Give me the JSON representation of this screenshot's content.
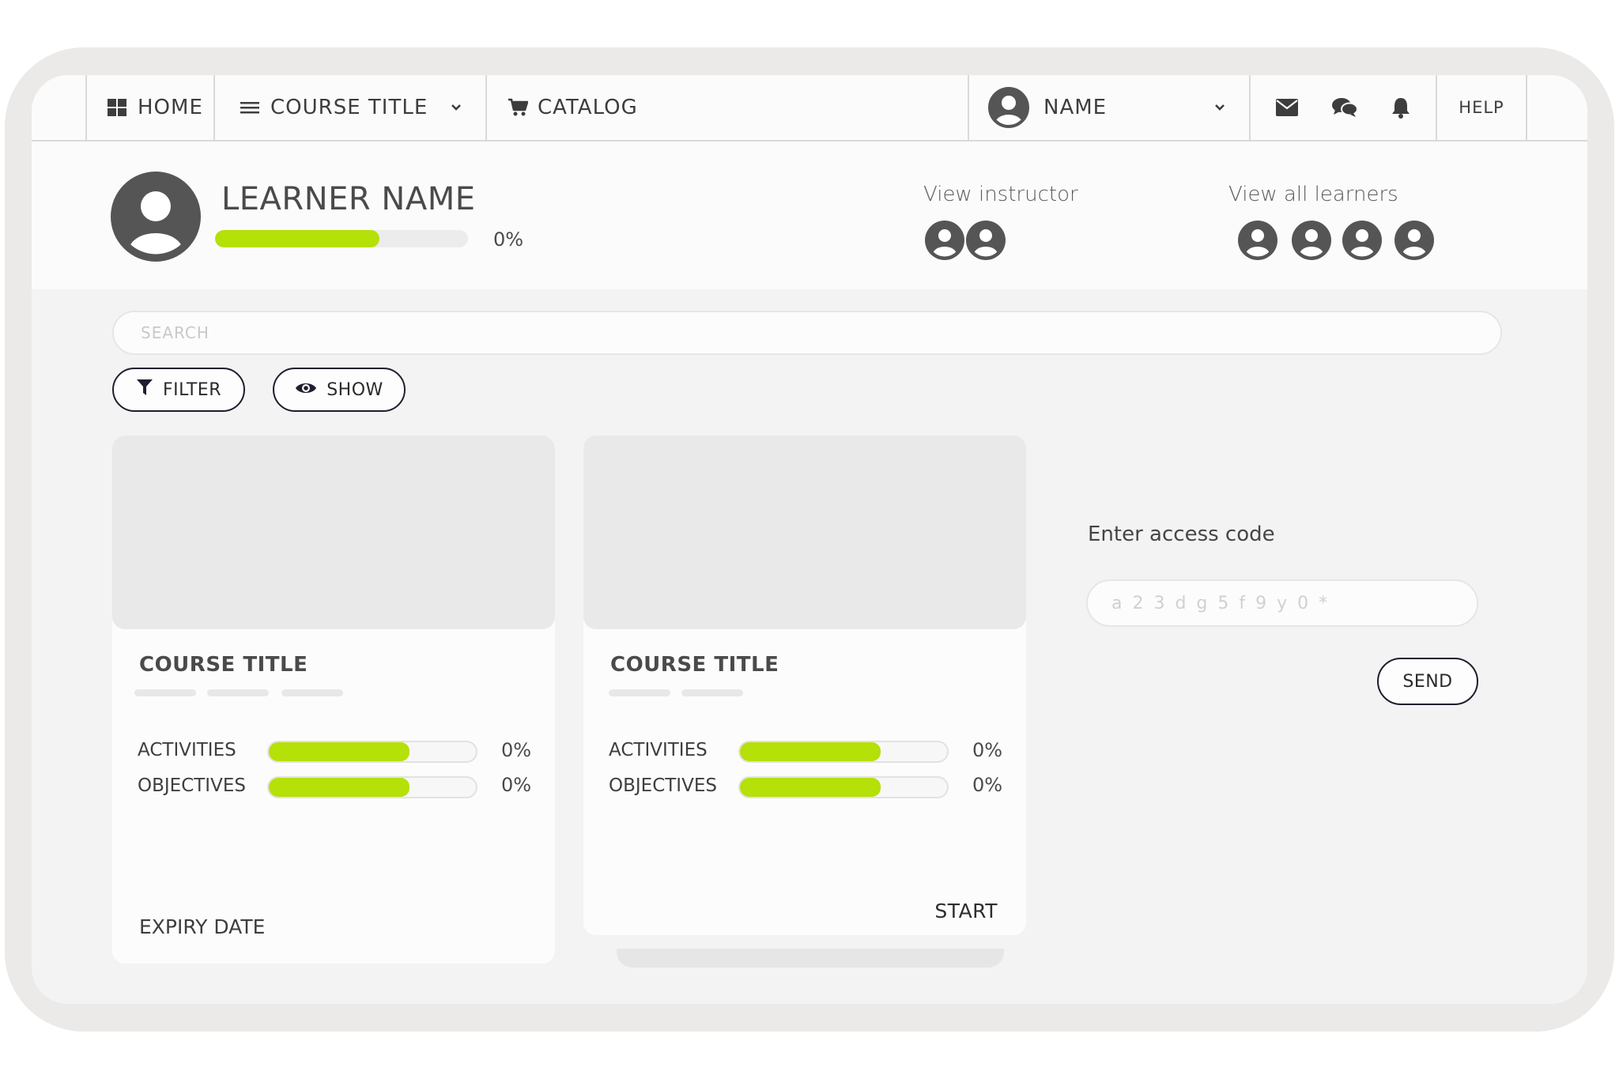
{
  "nav": {
    "home_label": "HOME",
    "course_label": "COURSE TITLE",
    "catalog_label": "CATALOG",
    "user_name": "NAME",
    "help_label": "HELP"
  },
  "profile": {
    "learner_name": "LEARNER NAME",
    "progress": 0.65,
    "progress_text": "0%",
    "view_instructor": "View instructor",
    "view_learners": "View all learners"
  },
  "search": {
    "placeholder": "SEARCH"
  },
  "buttons": {
    "filter": "FILTER",
    "show": "SHOW",
    "send": "SEND"
  },
  "cards": [
    {
      "title": "COURSE TITLE",
      "activities_label": "ACTIVITIES",
      "activities_pct": "0%",
      "activities_progress": 0.68,
      "objectives_label": "OBJECTIVES",
      "objectives_pct": "0%",
      "objectives_progress": 0.68,
      "footer": "EXPIRY DATE"
    },
    {
      "title": "COURSE TITLE",
      "activities_label": "ACTIVITIES",
      "activities_pct": "0%",
      "activities_progress": 0.68,
      "objectives_label": "OBJECTIVES",
      "objectives_pct": "0%",
      "objectives_progress": 0.68,
      "footer": "START"
    }
  ],
  "access": {
    "label": "Enter access code",
    "placeholder": "a 2 3 d g 5 f 9 y 0 *"
  },
  "colors": {
    "accent": "#b5e008",
    "icon": "#3d3d3d",
    "outline": "#1e1e2e"
  },
  "icons": [
    "grid-icon",
    "menu-icon",
    "chevron-down-icon",
    "cart-icon",
    "user-avatar-icon",
    "mail-icon",
    "chat-icon",
    "bell-icon",
    "filter-icon",
    "eye-icon"
  ]
}
